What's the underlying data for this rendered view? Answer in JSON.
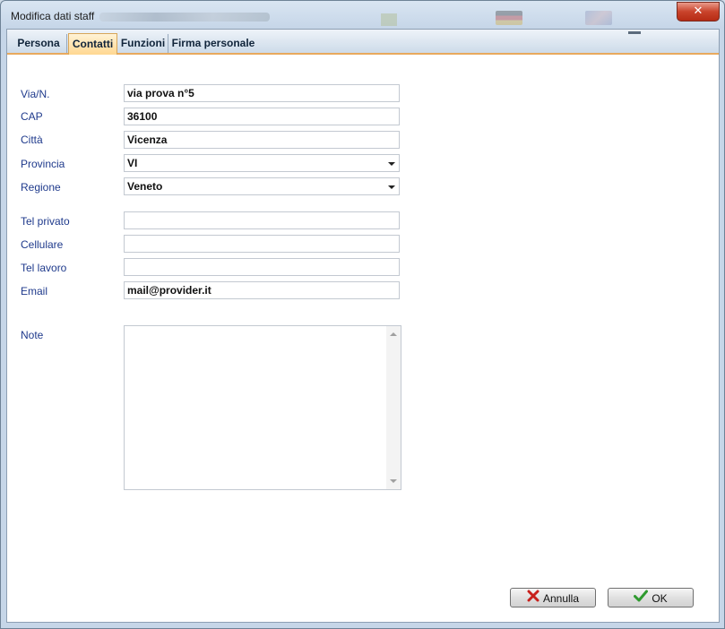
{
  "window": {
    "title": "Modifica dati staff",
    "close_label": "✕"
  },
  "tabs": [
    {
      "label": "Persona",
      "active": false
    },
    {
      "label": "Contatti",
      "active": true
    },
    {
      "label": "Funzioni",
      "active": false
    },
    {
      "label": "Firma personale",
      "active": false
    }
  ],
  "form": {
    "via": {
      "label": "Via/N.",
      "value": "via prova n°5"
    },
    "cap": {
      "label": "CAP",
      "value": "36100"
    },
    "citta": {
      "label": "Città",
      "value": "Vicenza"
    },
    "provincia": {
      "label": "Provincia",
      "value": "VI"
    },
    "regione": {
      "label": "Regione",
      "value": "Veneto"
    },
    "tel_privato": {
      "label": "Tel privato",
      "value": ""
    },
    "cellulare": {
      "label": "Cellulare",
      "value": ""
    },
    "tel_lavoro": {
      "label": "Tel lavoro",
      "value": ""
    },
    "email": {
      "label": "Email",
      "value": "mail@provider.it"
    },
    "note": {
      "label": "Note",
      "value": ""
    }
  },
  "buttons": {
    "cancel_label": "Annulla",
    "ok_label": "OK"
  },
  "icons": {
    "cancel": "x-icon",
    "ok": "check-icon"
  },
  "colors": {
    "label_text": "#1f3a8c",
    "active_tab": "#ffd790",
    "tab_underline": "#e8a95d",
    "close_button": "#c9432b"
  }
}
